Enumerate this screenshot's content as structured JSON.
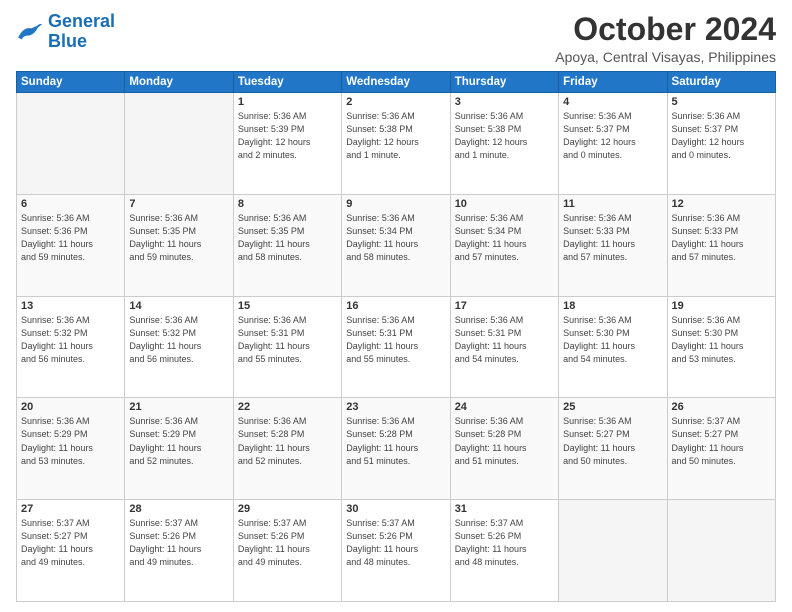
{
  "header": {
    "logo_line1": "General",
    "logo_line2": "Blue",
    "month": "October 2024",
    "location": "Apoya, Central Visayas, Philippines"
  },
  "weekdays": [
    "Sunday",
    "Monday",
    "Tuesday",
    "Wednesday",
    "Thursday",
    "Friday",
    "Saturday"
  ],
  "weeks": [
    [
      {
        "day": "",
        "info": ""
      },
      {
        "day": "",
        "info": ""
      },
      {
        "day": "1",
        "info": "Sunrise: 5:36 AM\nSunset: 5:39 PM\nDaylight: 12 hours\nand 2 minutes."
      },
      {
        "day": "2",
        "info": "Sunrise: 5:36 AM\nSunset: 5:38 PM\nDaylight: 12 hours\nand 1 minute."
      },
      {
        "day": "3",
        "info": "Sunrise: 5:36 AM\nSunset: 5:38 PM\nDaylight: 12 hours\nand 1 minute."
      },
      {
        "day": "4",
        "info": "Sunrise: 5:36 AM\nSunset: 5:37 PM\nDaylight: 12 hours\nand 0 minutes."
      },
      {
        "day": "5",
        "info": "Sunrise: 5:36 AM\nSunset: 5:37 PM\nDaylight: 12 hours\nand 0 minutes."
      }
    ],
    [
      {
        "day": "6",
        "info": "Sunrise: 5:36 AM\nSunset: 5:36 PM\nDaylight: 11 hours\nand 59 minutes."
      },
      {
        "day": "7",
        "info": "Sunrise: 5:36 AM\nSunset: 5:35 PM\nDaylight: 11 hours\nand 59 minutes."
      },
      {
        "day": "8",
        "info": "Sunrise: 5:36 AM\nSunset: 5:35 PM\nDaylight: 11 hours\nand 58 minutes."
      },
      {
        "day": "9",
        "info": "Sunrise: 5:36 AM\nSunset: 5:34 PM\nDaylight: 11 hours\nand 58 minutes."
      },
      {
        "day": "10",
        "info": "Sunrise: 5:36 AM\nSunset: 5:34 PM\nDaylight: 11 hours\nand 57 minutes."
      },
      {
        "day": "11",
        "info": "Sunrise: 5:36 AM\nSunset: 5:33 PM\nDaylight: 11 hours\nand 57 minutes."
      },
      {
        "day": "12",
        "info": "Sunrise: 5:36 AM\nSunset: 5:33 PM\nDaylight: 11 hours\nand 57 minutes."
      }
    ],
    [
      {
        "day": "13",
        "info": "Sunrise: 5:36 AM\nSunset: 5:32 PM\nDaylight: 11 hours\nand 56 minutes."
      },
      {
        "day": "14",
        "info": "Sunrise: 5:36 AM\nSunset: 5:32 PM\nDaylight: 11 hours\nand 56 minutes."
      },
      {
        "day": "15",
        "info": "Sunrise: 5:36 AM\nSunset: 5:31 PM\nDaylight: 11 hours\nand 55 minutes."
      },
      {
        "day": "16",
        "info": "Sunrise: 5:36 AM\nSunset: 5:31 PM\nDaylight: 11 hours\nand 55 minutes."
      },
      {
        "day": "17",
        "info": "Sunrise: 5:36 AM\nSunset: 5:31 PM\nDaylight: 11 hours\nand 54 minutes."
      },
      {
        "day": "18",
        "info": "Sunrise: 5:36 AM\nSunset: 5:30 PM\nDaylight: 11 hours\nand 54 minutes."
      },
      {
        "day": "19",
        "info": "Sunrise: 5:36 AM\nSunset: 5:30 PM\nDaylight: 11 hours\nand 53 minutes."
      }
    ],
    [
      {
        "day": "20",
        "info": "Sunrise: 5:36 AM\nSunset: 5:29 PM\nDaylight: 11 hours\nand 53 minutes."
      },
      {
        "day": "21",
        "info": "Sunrise: 5:36 AM\nSunset: 5:29 PM\nDaylight: 11 hours\nand 52 minutes."
      },
      {
        "day": "22",
        "info": "Sunrise: 5:36 AM\nSunset: 5:28 PM\nDaylight: 11 hours\nand 52 minutes."
      },
      {
        "day": "23",
        "info": "Sunrise: 5:36 AM\nSunset: 5:28 PM\nDaylight: 11 hours\nand 51 minutes."
      },
      {
        "day": "24",
        "info": "Sunrise: 5:36 AM\nSunset: 5:28 PM\nDaylight: 11 hours\nand 51 minutes."
      },
      {
        "day": "25",
        "info": "Sunrise: 5:36 AM\nSunset: 5:27 PM\nDaylight: 11 hours\nand 50 minutes."
      },
      {
        "day": "26",
        "info": "Sunrise: 5:37 AM\nSunset: 5:27 PM\nDaylight: 11 hours\nand 50 minutes."
      }
    ],
    [
      {
        "day": "27",
        "info": "Sunrise: 5:37 AM\nSunset: 5:27 PM\nDaylight: 11 hours\nand 49 minutes."
      },
      {
        "day": "28",
        "info": "Sunrise: 5:37 AM\nSunset: 5:26 PM\nDaylight: 11 hours\nand 49 minutes."
      },
      {
        "day": "29",
        "info": "Sunrise: 5:37 AM\nSunset: 5:26 PM\nDaylight: 11 hours\nand 49 minutes."
      },
      {
        "day": "30",
        "info": "Sunrise: 5:37 AM\nSunset: 5:26 PM\nDaylight: 11 hours\nand 48 minutes."
      },
      {
        "day": "31",
        "info": "Sunrise: 5:37 AM\nSunset: 5:26 PM\nDaylight: 11 hours\nand 48 minutes."
      },
      {
        "day": "",
        "info": ""
      },
      {
        "day": "",
        "info": ""
      }
    ]
  ]
}
